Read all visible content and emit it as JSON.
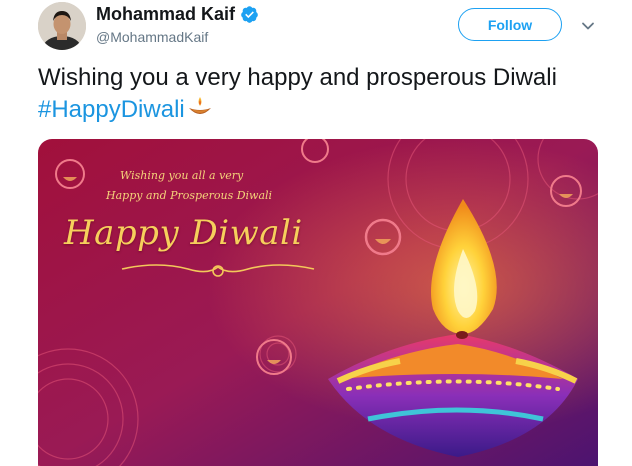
{
  "user": {
    "display_name": "Mohammad Kaif",
    "handle": "@MohammadKaif",
    "verified": true
  },
  "follow_label": "Follow",
  "tweet": {
    "text": "Wishing you a very happy and prosperous Diwali ",
    "hashtag": "#HappyDiwali",
    "emoji": "diya-emoji"
  },
  "image": {
    "line1": "Wishing you all a very",
    "line2": "Happy and Prosperous Diwali",
    "title": "Happy Diwali"
  },
  "colors": {
    "accent": "#1da1f2",
    "hashtag": "#1b95e0",
    "name": "#14171a",
    "handle": "#657786"
  }
}
